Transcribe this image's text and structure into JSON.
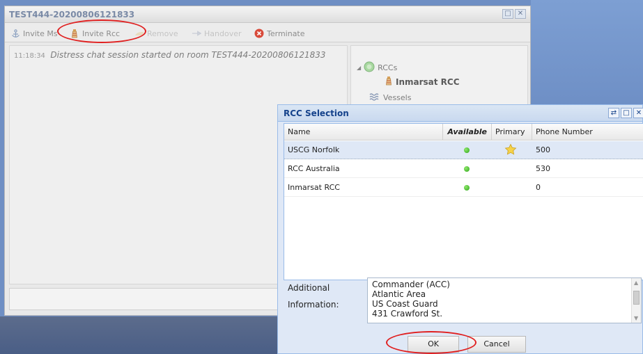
{
  "main_window": {
    "title": "TEST444-20200806121833",
    "toolbar": [
      {
        "label": "Invite Ms",
        "icon": "anchor-icon",
        "enabled": true
      },
      {
        "label": "Invite Rcc",
        "icon": "lighthouse-icon",
        "enabled": true
      },
      {
        "label": "Remove",
        "icon": "remove-icon",
        "enabled": false
      },
      {
        "label": "Handover",
        "icon": "handover-icon",
        "enabled": false
      },
      {
        "label": "Terminate",
        "icon": "terminate-icon",
        "enabled": true
      }
    ],
    "chat": {
      "time": "11:18:34",
      "message": "Distress chat session started on room TEST444-20200806121833"
    },
    "tree": {
      "rccs_label": "RCCs",
      "rcc_child": "Inmarsat RCC",
      "vessels_label": "Vessels"
    }
  },
  "dialog": {
    "title": "RCC Selection",
    "columns": {
      "name": "Name",
      "available": "Available",
      "primary": "Primary",
      "phone": "Phone Number"
    },
    "rows": [
      {
        "name": "USCG Norfolk",
        "available": true,
        "primary": true,
        "phone": "500"
      },
      {
        "name": "RCC Australia",
        "available": true,
        "primary": false,
        "phone": "530"
      },
      {
        "name": "Inmarsat RCC",
        "available": true,
        "primary": false,
        "phone": "0"
      }
    ],
    "additional_label_1": "Additional",
    "additional_label_2": "Information:",
    "additional_lines": [
      "Commander (ACC)",
      "Atlantic Area",
      "US Coast Guard",
      "431 Crawford St."
    ],
    "ok_label": "OK",
    "cancel_label": "Cancel"
  },
  "colors": {
    "dialog_title": "#15428b",
    "selected_row": "#dfe8f6",
    "annotation_ring": "#e02020",
    "available_dot": "#2fa51b"
  }
}
